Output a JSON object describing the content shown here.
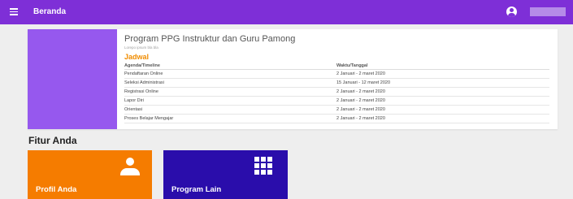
{
  "header": {
    "title": "Beranda",
    "menu_icon": "menu-icon",
    "account_icon": "account-circle-icon",
    "brand_color": "#7e2fd7"
  },
  "program_card": {
    "title": "Program PPG Instruktur dan Guru Pamong",
    "subtitle": "Lorepo ipsum bla bla",
    "section_title": "Jadwal",
    "columns": [
      "Agenda/Timeline",
      "Waktu/Tanggal"
    ],
    "rows": [
      [
        "Pendaftaran Online",
        "2 Januari - 2 maret 2020"
      ],
      [
        "Seleksi Administrasi",
        "15 Januari - 12 maret 2020"
      ],
      [
        "Registrasi Online",
        "2 Januari - 2 maret 2020"
      ],
      [
        "Lapor Diri",
        "2 Januari - 2 maret 2020"
      ],
      [
        "Orientasi",
        "2 Januari - 2 maret 2020"
      ],
      [
        "Proses Belajar Mengajar",
        "2 Januari - 2 maret 2020"
      ]
    ]
  },
  "features": {
    "title": "Fitur Anda",
    "tiles": [
      {
        "label": "Profil Anda",
        "icon": "person-icon",
        "color": "#f57c00"
      },
      {
        "label": "Program Lain",
        "icon": "apps-grid-icon",
        "color": "#2a0dab"
      }
    ]
  }
}
